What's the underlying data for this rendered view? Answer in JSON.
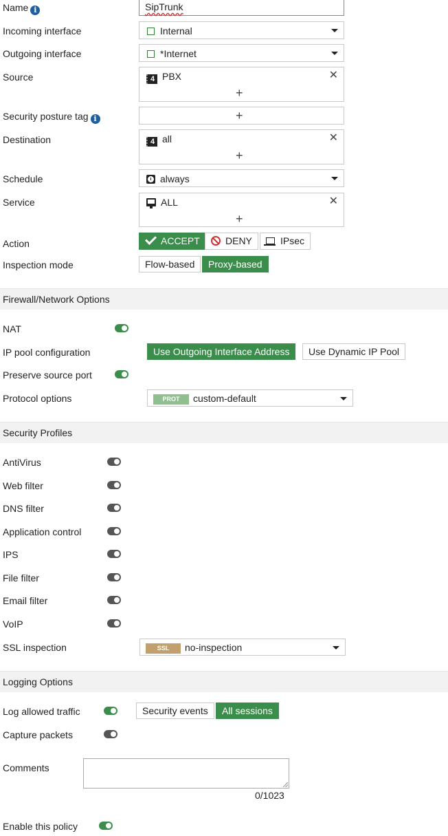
{
  "form": {
    "name_label": "Name",
    "name_value": "SipTrunk",
    "incoming_label": "Incoming interface",
    "incoming_value": "Internal",
    "outgoing_label": "Outgoing interface",
    "outgoing_value": "*Internet",
    "source_label": "Source",
    "source_value": "PBX",
    "posture_label": "Security posture tag",
    "destination_label": "Destination",
    "destination_value": "all",
    "schedule_label": "Schedule",
    "schedule_value": "always",
    "service_label": "Service",
    "service_value": "ALL",
    "action_label": "Action",
    "action_accept": "ACCEPT",
    "action_deny": "DENY",
    "action_ipsec": "IPsec",
    "action_selected": "ACCEPT",
    "inspection_label": "Inspection mode",
    "inspection_flow": "Flow-based",
    "inspection_proxy": "Proxy-based",
    "inspection_selected": "Proxy-based",
    "add_symbol": "+",
    "remove_symbol": "✕",
    "info_symbol": "i",
    "addr_icon_text": "4"
  },
  "firewall": {
    "section_title": "Firewall/Network Options",
    "nat_label": "NAT",
    "nat_enabled": true,
    "ippool_label": "IP pool configuration",
    "ippool_outgoing": "Use Outgoing Interface Address",
    "ippool_dynamic": "Use Dynamic IP Pool",
    "ippool_selected": "Use Outgoing Interface Address",
    "preserve_label": "Preserve source port",
    "preserve_enabled": true,
    "protocol_label": "Protocol options",
    "protocol_badge": "PROT",
    "protocol_value": "custom-default"
  },
  "security": {
    "section_title": "Security Profiles",
    "profiles": [
      {
        "label": "AntiVirus",
        "enabled": false
      },
      {
        "label": "Web filter",
        "enabled": false
      },
      {
        "label": "DNS filter",
        "enabled": false
      },
      {
        "label": "Application control",
        "enabled": false
      },
      {
        "label": "IPS",
        "enabled": false
      },
      {
        "label": "File filter",
        "enabled": false
      },
      {
        "label": "Email filter",
        "enabled": false
      },
      {
        "label": "VoIP",
        "enabled": false
      }
    ],
    "ssl_label": "SSL inspection",
    "ssl_badge": "SSL",
    "ssl_value": "no-inspection"
  },
  "logging": {
    "section_title": "Logging Options",
    "log_label": "Log allowed traffic",
    "log_enabled": true,
    "log_security": "Security events",
    "log_all": "All sessions",
    "log_selected": "All sessions",
    "capture_label": "Capture packets",
    "capture_enabled": false,
    "comments_label": "Comments",
    "comments_value": "",
    "comments_counter": "0/1023",
    "enable_label": "Enable this policy",
    "enable_enabled": true
  },
  "colors": {
    "accent": "#3a8d4a",
    "info": "#1e5fa0",
    "prot_badge": "#8fbf8f",
    "ssl_badge": "#c2a06e",
    "deny": "#d32f2f"
  },
  "icons": {
    "interface": "square-outline-icon",
    "address": "address-group-icon",
    "schedule": "clock-icon",
    "service": "service-icon",
    "accept": "check-icon",
    "deny": "ban-icon",
    "ipsec": "laptop-icon",
    "dropdown": "caret-down-icon",
    "info": "info-icon",
    "remove": "close-icon",
    "add": "plus-icon"
  }
}
